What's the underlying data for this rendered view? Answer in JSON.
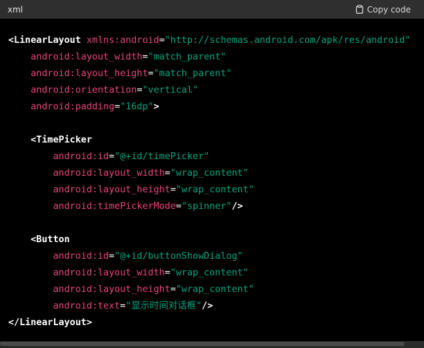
{
  "header": {
    "language": "xml",
    "copy_label": "Copy code"
  },
  "code": {
    "l1_tag": "<LinearLayout",
    "l1_attr": "xmlns:android",
    "l1_eq": "=",
    "l1_val": "\"http://schemas.android.com/apk/res/android\"",
    "l2_attr": "android:layout_width",
    "l2_val": "\"match_parent\"",
    "l3_attr": "android:layout_height",
    "l3_val": "\"match_parent\"",
    "l4_attr": "android:orientation",
    "l4_val": "\"vertical\"",
    "l5_attr": "android:padding",
    "l5_val": "\"16dp\"",
    "l5_close": ">",
    "l7_tag": "<TimePicker",
    "l8_attr": "android:id",
    "l8_val": "\"@+id/timePicker\"",
    "l9_attr": "android:layout_width",
    "l9_val": "\"wrap_content\"",
    "l10_attr": "android:layout_height",
    "l10_val": "\"wrap_content\"",
    "l11_attr": "android:timePickerMode",
    "l11_val": "\"spinner\"",
    "l11_close": "/>",
    "l13_tag": "<Button",
    "l14_attr": "android:id",
    "l14_val": "\"@+id/buttonShowDialog\"",
    "l15_attr": "android:layout_width",
    "l15_val": "\"wrap_content\"",
    "l16_attr": "android:layout_height",
    "l16_val": "\"wrap_content\"",
    "l17_attr": "android:text",
    "l17_val": "\"显示时间对话框\"",
    "l17_close": "/>",
    "l18_tag": "</LinearLayout>"
  },
  "colors": {
    "tag": "#ffffff",
    "attribute": "#e9457d",
    "string": "#00a67d",
    "header_bg": "#2f2f2f",
    "code_bg": "#000000"
  }
}
